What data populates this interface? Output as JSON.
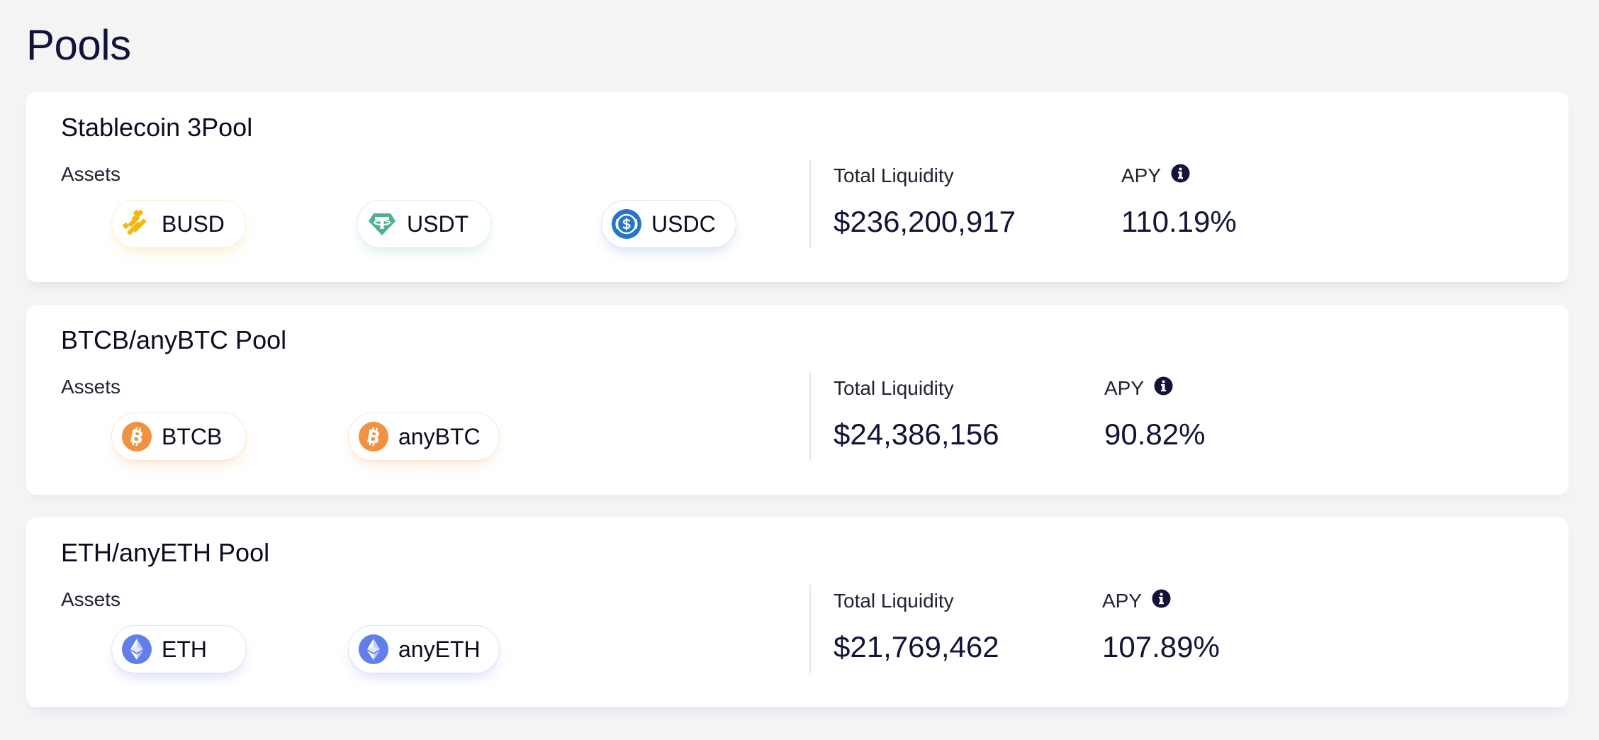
{
  "page": {
    "title": "Pools"
  },
  "labels": {
    "assets": "Assets",
    "total_liquidity": "Total Liquidity",
    "apy": "APY"
  },
  "icons": {
    "busd": "binance-usd-icon",
    "usdt": "tether-icon",
    "usdc": "usd-coin-icon",
    "btc": "bitcoin-icon",
    "eth": "ethereum-icon",
    "info": "info-icon"
  },
  "colors": {
    "title": "#111436",
    "busd": "#F0B90B",
    "usdt": "#50AF95",
    "usdc": "#2775CA",
    "btc": "#F09242",
    "eth": "#627EEA"
  },
  "pools": [
    {
      "name": "Stablecoin 3Pool",
      "assets": [
        {
          "symbol": "BUSD"
        },
        {
          "symbol": "USDT"
        },
        {
          "symbol": "USDC"
        }
      ],
      "total_liquidity": "$236,200,917",
      "apy": "110.19%"
    },
    {
      "name": "BTCB/anyBTC Pool",
      "assets": [
        {
          "symbol": "BTCB"
        },
        {
          "symbol": "anyBTC"
        }
      ],
      "total_liquidity": "$24,386,156",
      "apy": "90.82%"
    },
    {
      "name": "ETH/anyETH Pool",
      "assets": [
        {
          "symbol": "ETH"
        },
        {
          "symbol": "anyETH"
        }
      ],
      "total_liquidity": "$21,769,462",
      "apy": "107.89%"
    }
  ]
}
